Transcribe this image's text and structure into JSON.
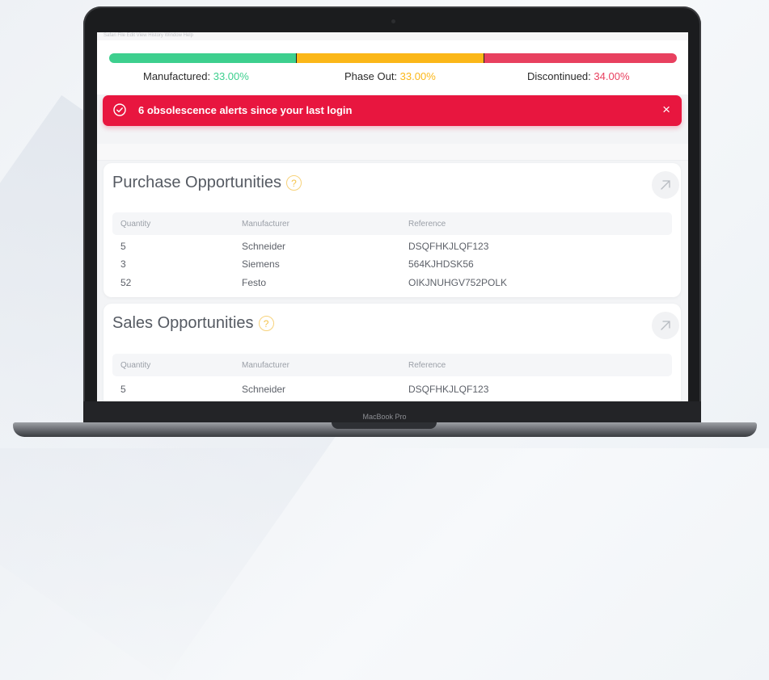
{
  "device": {
    "model_label": "MacBook Pro"
  },
  "menubar": {
    "text": "Safari  File  Edit  View  History  Window  Help"
  },
  "colors": {
    "manufactured": "#3dcf8e",
    "phase_out": "#fbb718",
    "discontinued": "#e8405f",
    "alert_bg": "#e8163f",
    "help_accent": "#f5c44e"
  },
  "lifecycle": {
    "manufactured": {
      "label": "Manufactured:",
      "value": "33.00%",
      "percent": 33
    },
    "phase_out": {
      "label": "Phase Out:",
      "value": "33.00%",
      "percent": 33
    },
    "discontinued": {
      "label": "Discontinued:",
      "value": "34.00%",
      "percent": 34
    }
  },
  "alert": {
    "icon": "check-circle-icon",
    "text": "6 obsolescence alerts since your last login",
    "close_label": "×"
  },
  "purchase": {
    "title": "Purchase Opportunities",
    "help_label": "?",
    "expand_icon": "arrow-up-right-icon",
    "columns": [
      "Quantity",
      "Manufacturer",
      "Reference"
    ],
    "rows": [
      {
        "quantity": "5",
        "manufacturer": "Schneider",
        "reference": "DSQFHKJLQF123"
      },
      {
        "quantity": "3",
        "manufacturer": "Siemens",
        "reference": "564KJHDSK56"
      },
      {
        "quantity": "52",
        "manufacturer": "Festo",
        "reference": "OIKJNUHGV752POLK"
      }
    ]
  },
  "sales": {
    "title": "Sales Opportunities",
    "help_label": "?",
    "expand_icon": "arrow-up-right-icon",
    "columns": [
      "Quantity",
      "Manufacturer",
      "Reference"
    ],
    "rows": [
      {
        "quantity": "5",
        "manufacturer": "Schneider",
        "reference": "DSQFHKJLQF123"
      }
    ]
  }
}
